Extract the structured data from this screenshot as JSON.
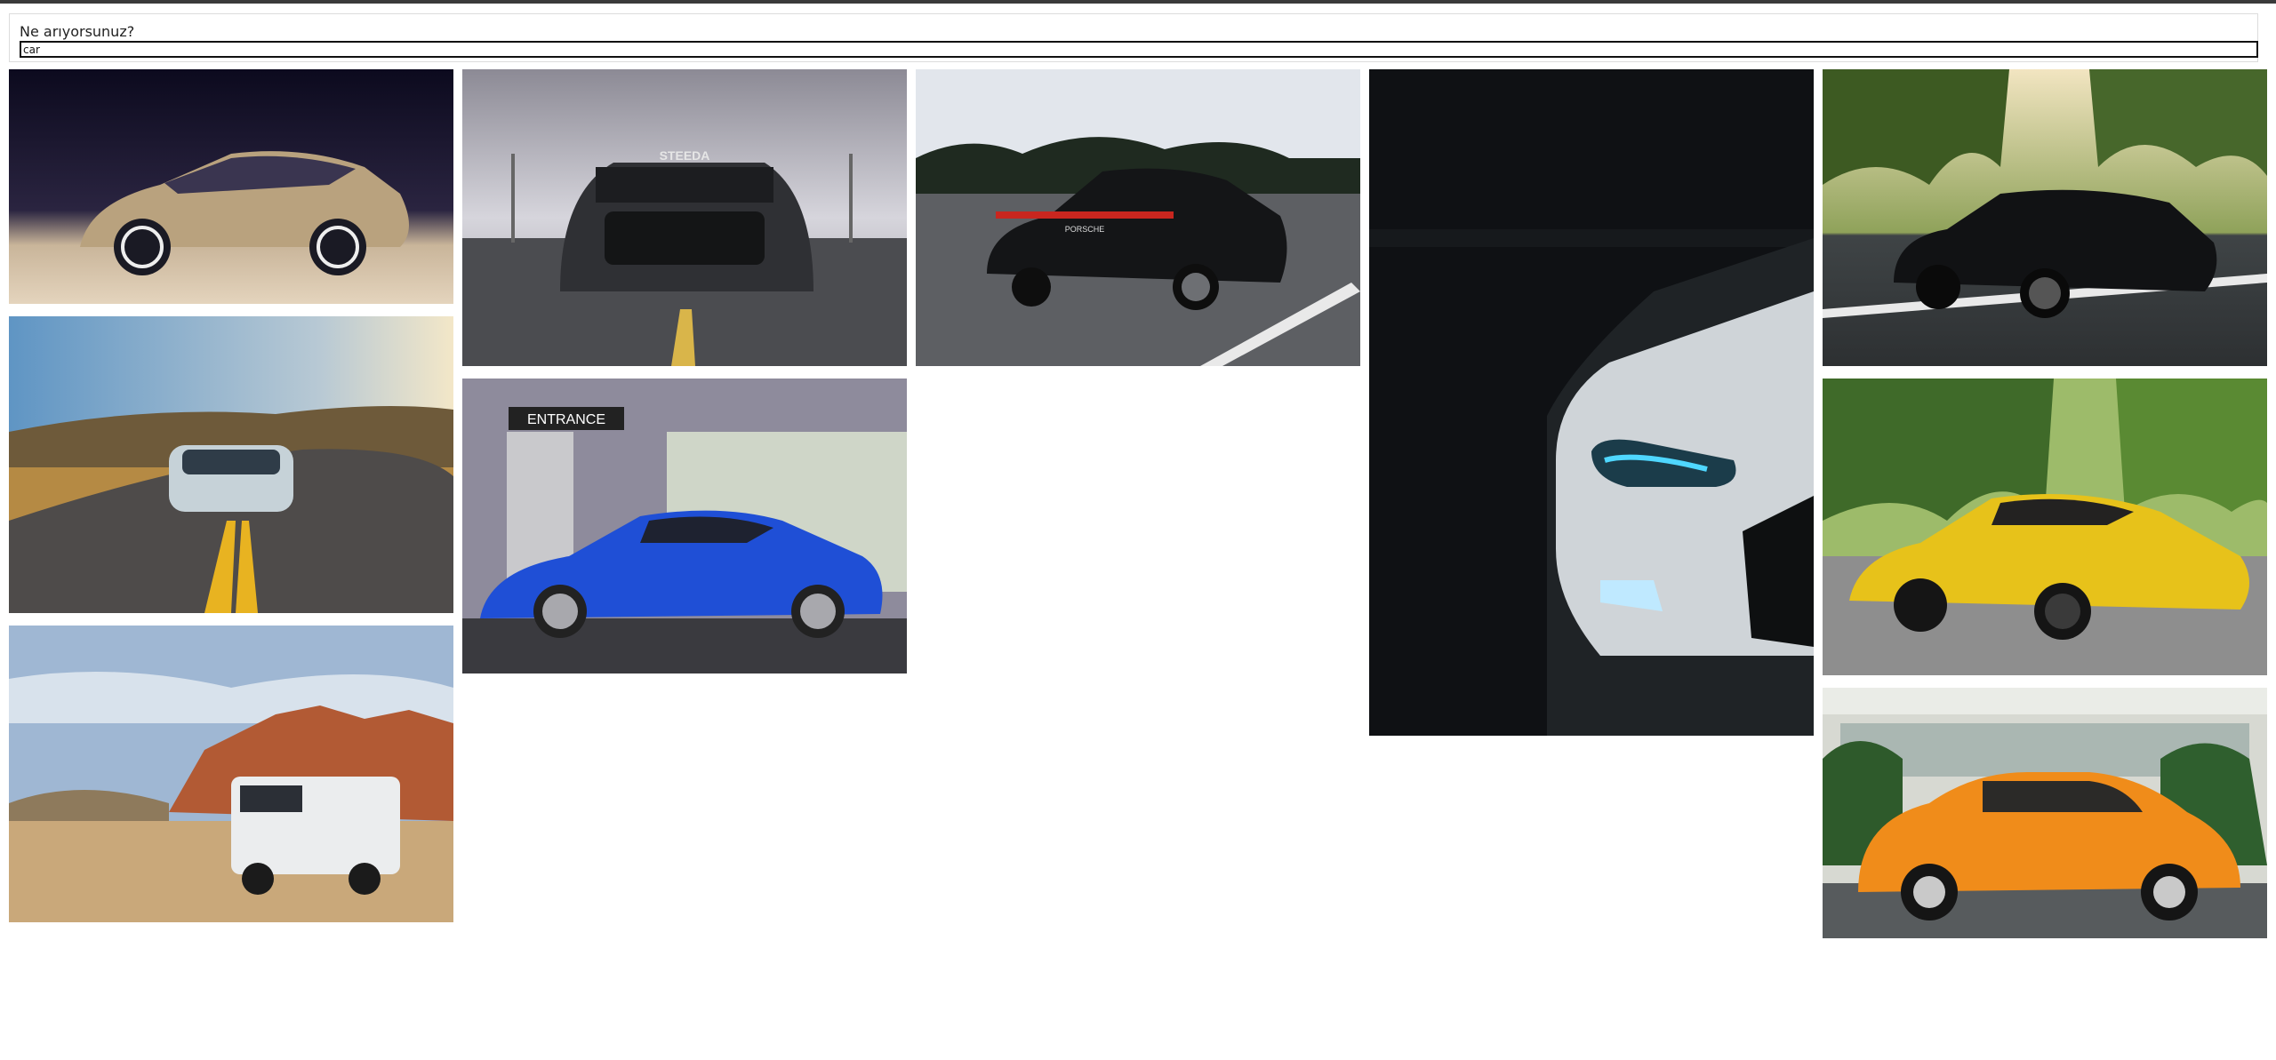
{
  "search": {
    "label": "Ne arıyorsunuz?",
    "value": "car"
  },
  "results": [
    {
      "name": "concept-sketch-car-photo",
      "subject": "gold concept car sketch"
    },
    {
      "name": "nissan-gtr-road-photo",
      "subject": "silver sports car on country road"
    },
    {
      "name": "white-suv-desert-photo",
      "subject": "white SUV in red rock desert"
    },
    {
      "name": "black-mustang-front-photo",
      "subject": "black muscle car front view",
      "plate_text": "STEEDA"
    },
    {
      "name": "blue-coupe-entrance-photo",
      "subject": "blue coupe in front of building",
      "sign_text": "ENTRANCE"
    },
    {
      "name": "porsche-panamera-photo",
      "subject": "black sedan on highway",
      "badge_text": "PORSCHE"
    },
    {
      "name": "audi-headlight-photo",
      "subject": "white car headlight in dark garage"
    },
    {
      "name": "black-mustang-parking-photo",
      "subject": "black muscle car in parking lot"
    },
    {
      "name": "yellow-lamborghini-photo",
      "subject": "yellow supercar on street"
    },
    {
      "name": "orange-beetle-photo",
      "subject": "orange vintage beetle"
    }
  ]
}
